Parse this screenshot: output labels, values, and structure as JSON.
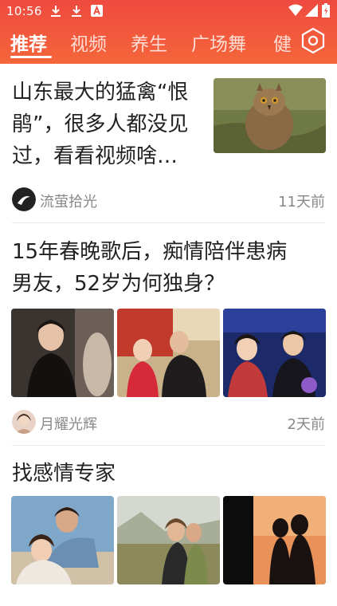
{
  "status": {
    "time": "10:56",
    "left_icons": [
      "download-icon",
      "download-icon",
      "font-a-icon"
    ],
    "right_icons": [
      "wifi-icon",
      "signal-icon",
      "battery-icon"
    ]
  },
  "tabs": [
    {
      "label": "推荐",
      "active": true
    },
    {
      "label": "视频",
      "active": false
    },
    {
      "label": "养生",
      "active": false
    },
    {
      "label": "广场舞",
      "active": false
    },
    {
      "label": "健",
      "active": false
    }
  ],
  "settings_icon": "hexagon-settings-icon",
  "articles": [
    {
      "title_lines": [
        "山东最大的猛禽“恨",
        "鹃”，很多人都没见",
        "过，看看视频啥…"
      ],
      "source": "流萤拾光",
      "time": "11天前",
      "images": 1
    },
    {
      "title_lines": [
        "15年春晚歌后，痴情陪伴患病",
        "男友，52岁为何独身？"
      ],
      "source": "月耀光辉",
      "time": "2天前",
      "images": 3
    },
    {
      "title_lines": [
        "找感情专家"
      ],
      "images": 3
    }
  ],
  "colors": {
    "header_top": "#ef4a40",
    "header_bottom": "#f4663a",
    "meta_text": "#888888"
  }
}
